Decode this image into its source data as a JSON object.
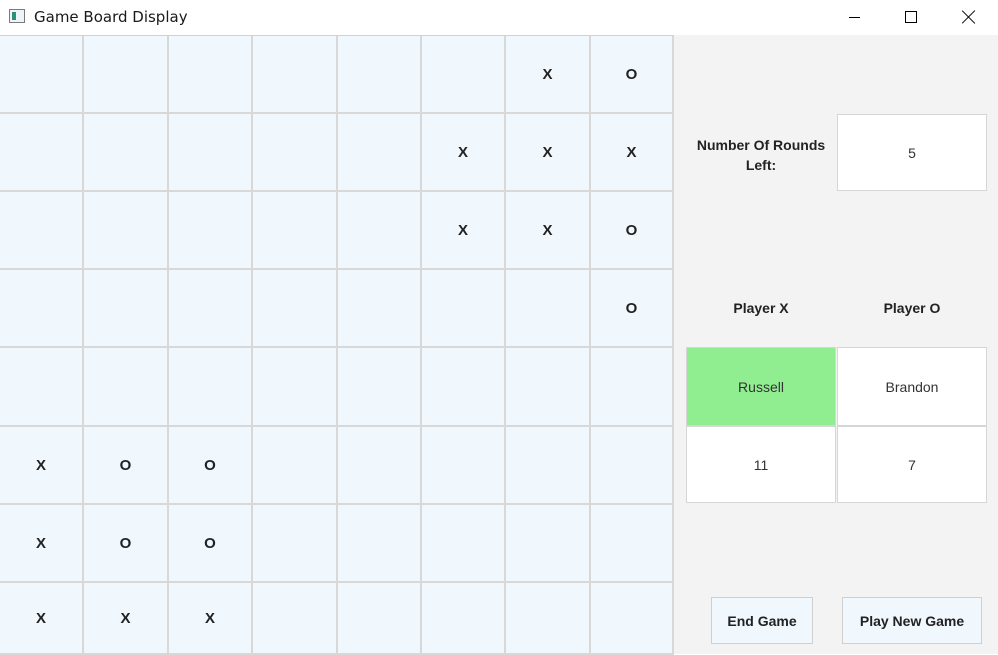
{
  "window": {
    "title": "Game Board Display"
  },
  "board": {
    "rows": [
      [
        "",
        "",
        "",
        "",
        "",
        "",
        "X",
        "O"
      ],
      [
        "",
        "",
        "",
        "",
        "",
        "X",
        "X",
        "X"
      ],
      [
        "",
        "",
        "",
        "",
        "",
        "X",
        "X",
        "O"
      ],
      [
        "",
        "",
        "",
        "",
        "",
        "",
        "",
        "O"
      ],
      [
        "",
        "",
        "",
        "",
        "",
        "",
        "",
        ""
      ],
      [
        "X",
        "O",
        "O",
        "",
        "",
        "",
        "",
        ""
      ],
      [
        "X",
        "O",
        "O",
        "",
        "",
        "",
        "",
        ""
      ],
      [
        "X",
        "X",
        "X",
        "",
        "",
        "",
        "",
        ""
      ]
    ]
  },
  "panel": {
    "rounds_label": "Number Of Rounds Left:",
    "rounds_value": "5",
    "player_x_header": "Player X",
    "player_o_header": "Player O",
    "player_x_name": "Russell",
    "player_o_name": "Brandon",
    "player_x_score": "11",
    "player_o_score": "7",
    "end_game_label": "End Game",
    "play_new_game_label": "Play New Game"
  },
  "colors": {
    "active_player": "#90ee90",
    "board_cell": "#f0f7fd",
    "panel_bg": "#f3f3f3"
  },
  "state": {
    "active_player": "X"
  }
}
